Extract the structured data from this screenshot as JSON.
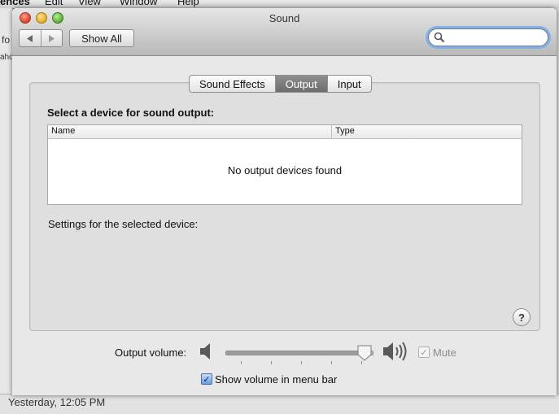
{
  "background": {
    "menubar_items": [
      "ences",
      "Edit",
      "View",
      "Window",
      "Help"
    ],
    "left_fragments": [
      "fo",
      "aho"
    ],
    "timestamp": "Yesterday, 12:05 PM"
  },
  "window": {
    "title": "Sound",
    "show_all_label": "Show All",
    "search_placeholder": "",
    "search_value": ""
  },
  "tabs": [
    {
      "label": "Sound Effects",
      "active": false
    },
    {
      "label": "Output",
      "active": true
    },
    {
      "label": "Input",
      "active": false
    }
  ],
  "output": {
    "section_label": "Select a device for sound output:",
    "columns": [
      "Name",
      "Type"
    ],
    "empty_message": "No output devices found",
    "settings_label": "Settings for the selected device:",
    "help_label": "?"
  },
  "volume": {
    "label": "Output volume:",
    "level": 0.95,
    "mute_label": "Mute",
    "mute_checked": true,
    "mute_enabled": false,
    "menubar_label": "Show volume in menu bar",
    "menubar_checked": true
  },
  "colors": {
    "search_focus_ring": "#7fb2ea",
    "active_tab": "#7a7a7a"
  }
}
